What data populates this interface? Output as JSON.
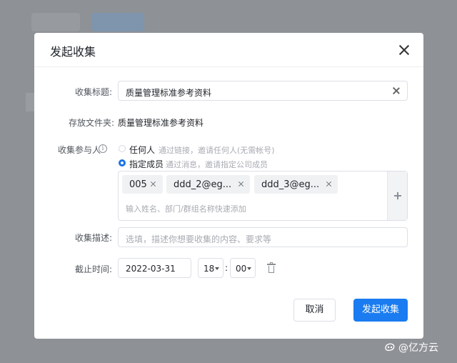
{
  "background": {
    "overlay_color": "#8e9196"
  },
  "dialog": {
    "title": "发起收集",
    "fields": {
      "title_label": "收集标题:",
      "title_value": "质量管理标准参考资料",
      "folder_label": "存放文件夹:",
      "folder_value": "质量管理标准参考资料",
      "participants_label": "收集参与人",
      "options": [
        {
          "label": "任何人",
          "hint": "通过链接，邀请任何人(无需帐号)",
          "selected": false
        },
        {
          "label": "指定成员",
          "hint": "通过消息，邀请指定公司成员",
          "selected": true
        }
      ],
      "members": [
        "005",
        "ddd_2@eg...",
        "ddd_3@eg..."
      ],
      "members_placeholder": "输入姓名、部门/群组名称快速添加",
      "description_label": "收集描述:",
      "description_placeholder": "选填，描述你想要收集的内容、要求等",
      "deadline_label": "截止时间:",
      "deadline_date": "2022-03-31",
      "deadline_hour": "18",
      "deadline_minute": "00"
    },
    "buttons": {
      "cancel": "取消",
      "submit": "发起收集"
    }
  },
  "watermark": {
    "text": "@亿方云"
  },
  "colors": {
    "primary": "#1a7cf0",
    "border": "#dcdfe6",
    "placeholder": "#a8abb2"
  },
  "icons": [
    "close-icon",
    "clear-icon",
    "info-icon",
    "tag-remove-icon",
    "plus-icon",
    "caret-down-icon",
    "trash-icon"
  ]
}
